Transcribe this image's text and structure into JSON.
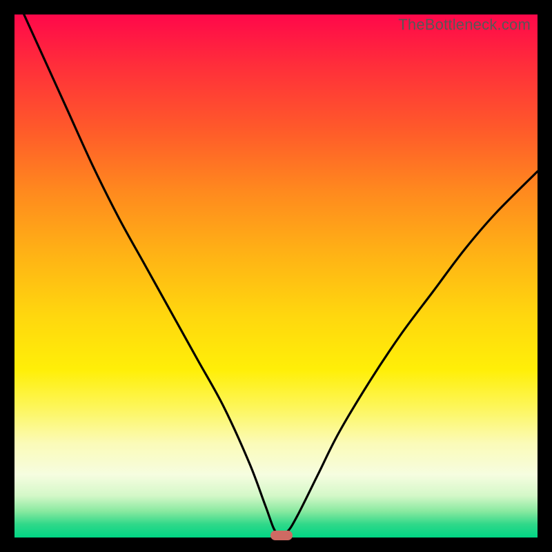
{
  "watermark": "TheBottleneck.com",
  "chart_data": {
    "type": "line",
    "title": "",
    "subtitle": "",
    "xlabel": "",
    "ylabel": "",
    "xlim": [
      0,
      100
    ],
    "ylim": [
      0,
      100
    ],
    "grid": false,
    "legend": false,
    "annotations": [],
    "background_gradient_stops": [
      {
        "pos": 0,
        "color": "#ff084a"
      },
      {
        "pos": 50,
        "color": "#ffd80e"
      },
      {
        "pos": 100,
        "color": "#00d584"
      }
    ],
    "marker": {
      "x": 51,
      "y": 0.4,
      "color": "#cf6a63"
    },
    "series": [
      {
        "name": "bottleneck-curve",
        "x": [
          0,
          5,
          10,
          15,
          20,
          25,
          30,
          35,
          40,
          45,
          48,
          50,
          52,
          54,
          58,
          62,
          68,
          74,
          80,
          86,
          92,
          100
        ],
        "values": [
          104,
          93,
          82,
          71,
          61,
          52,
          43,
          34,
          25,
          14,
          6,
          1,
          1,
          4,
          12,
          20,
          30,
          39,
          47,
          55,
          62,
          70
        ]
      }
    ],
    "notes": "x is normalized horizontal position (0–100 left→right); value is normalized height above bottom (0–100). Values >100 indicate the curve exits the top of the plot. Estimated visually from the image."
  }
}
